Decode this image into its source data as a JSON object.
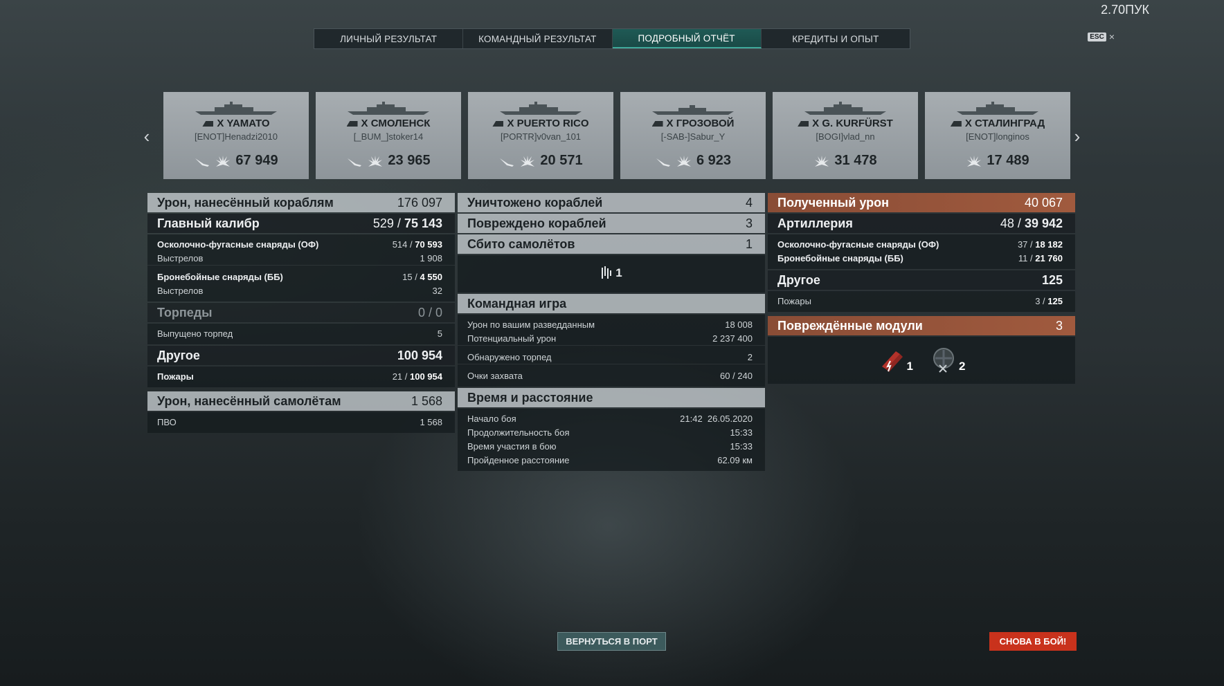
{
  "user": {
    "name": "2.70ПУК"
  },
  "esc": {
    "key": "ESC",
    "close": "×"
  },
  "tabs": [
    {
      "label": "ЛИЧНЫЙ РЕЗУЛЬТАТ",
      "active": false
    },
    {
      "label": "КОМАНДНЫЙ РЕЗУЛЬТАТ",
      "active": false
    },
    {
      "label": "ПОДРОБНЫЙ ОТЧЁТ",
      "active": true
    },
    {
      "label": "КРЕДИТЫ И ОПЫТ",
      "active": false
    }
  ],
  "ships": [
    {
      "name": "X YAMATO",
      "player": "[ENOT]Henadzi2010",
      "damage": "67 949",
      "torpedo_icon": true
    },
    {
      "name": "X СМОЛЕНСК",
      "player": "[_BUM_]stoker14",
      "damage": "23 965",
      "torpedo_icon": true
    },
    {
      "name": "X PUERTO RICO",
      "player": "[PORTR]v0van_101",
      "damage": "20 571",
      "torpedo_icon": true
    },
    {
      "name": "X ГРОЗОВОЙ",
      "player": "[-SAB-]Sabur_Y",
      "damage": "6 923",
      "torpedo_icon": true
    },
    {
      "name": "X G. KURFÜRST",
      "player": "[BOGI]vlad_nn",
      "damage": "31 478",
      "torpedo_icon": false
    },
    {
      "name": "X СТАЛИНГРАД",
      "player": "[ENOT]longinos",
      "damage": "17 489",
      "torpedo_icon": false
    }
  ],
  "col1": {
    "ship_damage": {
      "label": "Урон, нанесённый кораблям",
      "value": "176 097"
    },
    "main_battery": {
      "label": "Главный калибр",
      "value_a": "529 / ",
      "value_b": "75 143"
    },
    "he": {
      "label": "Осколочно-фугасные снаряды (ОФ)",
      "value_a": "514 / ",
      "value_b": "70 593"
    },
    "he_shots": {
      "label": "Выстрелов",
      "value": "1 908"
    },
    "ap": {
      "label": "Бронебойные снаряды (ББ)",
      "value_a": "15 / ",
      "value_b": "4 550"
    },
    "ap_shots": {
      "label": "Выстрелов",
      "value": "32"
    },
    "torpedoes": {
      "label": "Торпеды",
      "value": "0 / 0"
    },
    "torps_launched": {
      "label": "Выпущено торпед",
      "value": "5"
    },
    "other": {
      "label": "Другое",
      "value": "100 954"
    },
    "fires": {
      "label": "Пожары",
      "value_a": "21 / ",
      "value_b": "100 954"
    },
    "plane_damage": {
      "label": "Урон, нанесённый самолётам",
      "value": "1 568"
    },
    "aa": {
      "label": "ПВО",
      "value": "1 568"
    }
  },
  "col2": {
    "destroyed": {
      "label": "Уничтожено кораблей",
      "value": "4"
    },
    "damaged": {
      "label": "Повреждено кораблей",
      "value": "3"
    },
    "planes": {
      "label": "Сбито самолётов",
      "value": "1"
    },
    "planes_icon_count": "1",
    "teamplay": {
      "label": "Командная игра"
    },
    "spotting": {
      "label": "Урон по вашим разведданным",
      "value": "18 008"
    },
    "potential": {
      "label": "Потенциальный урон",
      "value": "2 237 400"
    },
    "torps_spotted": {
      "label": "Обнаружено торпед",
      "value": "2"
    },
    "capture": {
      "label": "Очки захвата",
      "value": "60 / 240"
    },
    "time": {
      "label": "Время и расстояние"
    },
    "start": {
      "label": "Начало боя",
      "value": "21:42  26.05.2020"
    },
    "duration": {
      "label": "Продолжительность боя",
      "value": "15:33"
    },
    "in_battle": {
      "label": "Время участия в бою",
      "value": "15:33"
    },
    "distance": {
      "label": "Пройденное расстояние",
      "value": "62.09 км"
    }
  },
  "col3": {
    "received": {
      "label": "Полученный урон",
      "value": "40 067"
    },
    "artillery": {
      "label": "Артиллерия",
      "value_a": "48 / ",
      "value_b": "39 942"
    },
    "he": {
      "label": "Осколочно-фугасные снаряды (ОФ)",
      "value_a": "37 / ",
      "value_b": "18 182"
    },
    "ap": {
      "label": "Бронебойные снаряды (ББ)",
      "value_a": "11 / ",
      "value_b": "21 760"
    },
    "other": {
      "label": "Другое",
      "value": "125"
    },
    "fires": {
      "label": "Пожары",
      "value_a": "3 / ",
      "value_b": "125"
    },
    "modules": {
      "label": "Повреждённые модули",
      "value": "3"
    },
    "module_a": "1",
    "module_b": "2"
  },
  "buttons": {
    "port": "ВЕРНУТЬСЯ В ПОРТ",
    "battle": "СНОВА В БОЙ!"
  },
  "colors": {
    "accent_orange": "#c9321c",
    "tab_active": "#1f5a55",
    "received_header": "#a05a3e"
  }
}
